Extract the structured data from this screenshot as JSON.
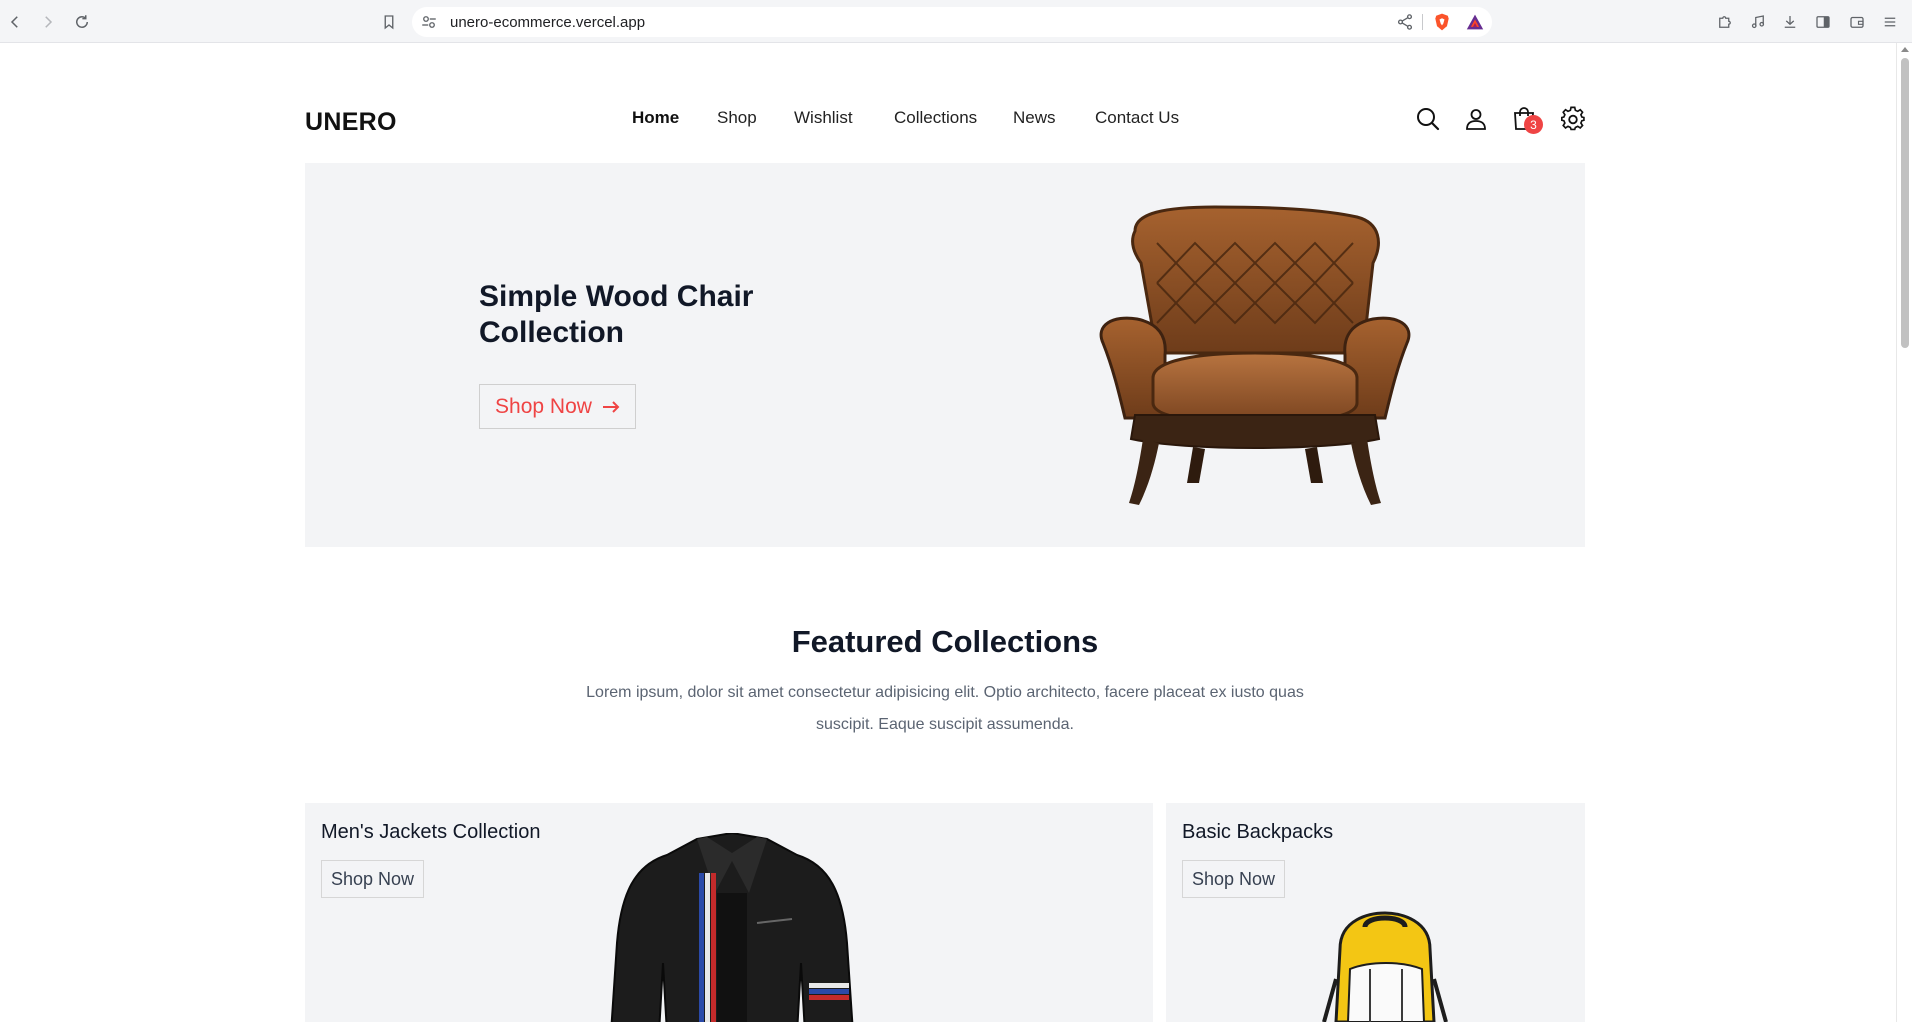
{
  "browser": {
    "url": "unero-ecommerce.vercel.app"
  },
  "header": {
    "logo": "UNERO",
    "nav": [
      "Home",
      "Shop",
      "Wishlist",
      "Collections",
      "News",
      "Contact Us"
    ],
    "active_nav": "Home",
    "cart_count": "3",
    "icons": [
      "search-icon",
      "user-icon",
      "cart-icon",
      "gear-icon"
    ]
  },
  "hero": {
    "title": "Simple Wood Chair Collection",
    "button_label": "Shop Now",
    "button_icon": "arrow-right-icon"
  },
  "featured": {
    "title": "Featured Collections",
    "description": "Lorem ipsum, dolor sit amet consectetur adipisicing elit. Optio architecto, facere placeat ex iusto quas suscipit. Eaque suscipit assumenda.",
    "cards": [
      {
        "title": "Men's Jackets Collection",
        "button_label": "Shop Now"
      },
      {
        "title": "Basic Backpacks",
        "button_label": "Shop Now"
      }
    ]
  },
  "colors": {
    "accent": "#ef4444",
    "panel_bg": "#f3f4f6",
    "text": "#111827",
    "muted": "#5b6472"
  }
}
